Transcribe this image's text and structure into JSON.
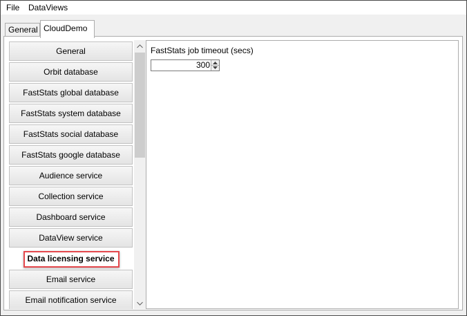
{
  "menubar": {
    "items": [
      {
        "label": "File"
      },
      {
        "label": "DataViews"
      }
    ]
  },
  "tabs": [
    {
      "label": "General",
      "active": false
    },
    {
      "label": "CloudDemo",
      "active": true
    }
  ],
  "list": {
    "items": [
      {
        "label": "General"
      },
      {
        "label": "Orbit database"
      },
      {
        "label": "FastStats global database"
      },
      {
        "label": "FastStats system database"
      },
      {
        "label": "FastStats social database"
      },
      {
        "label": "FastStats google database"
      },
      {
        "label": "Audience service"
      },
      {
        "label": "Collection service"
      },
      {
        "label": "Dashboard service"
      },
      {
        "label": "DataView service"
      },
      {
        "label": "Data licensing service"
      },
      {
        "label": "Email service"
      },
      {
        "label": "Email notification service"
      }
    ],
    "selected_index": 10
  },
  "settings": {
    "job_timeout_label": "FastStats job timeout (secs)",
    "job_timeout_value": "300"
  },
  "colors": {
    "highlight": "#e5484d",
    "border": "#acacac"
  }
}
